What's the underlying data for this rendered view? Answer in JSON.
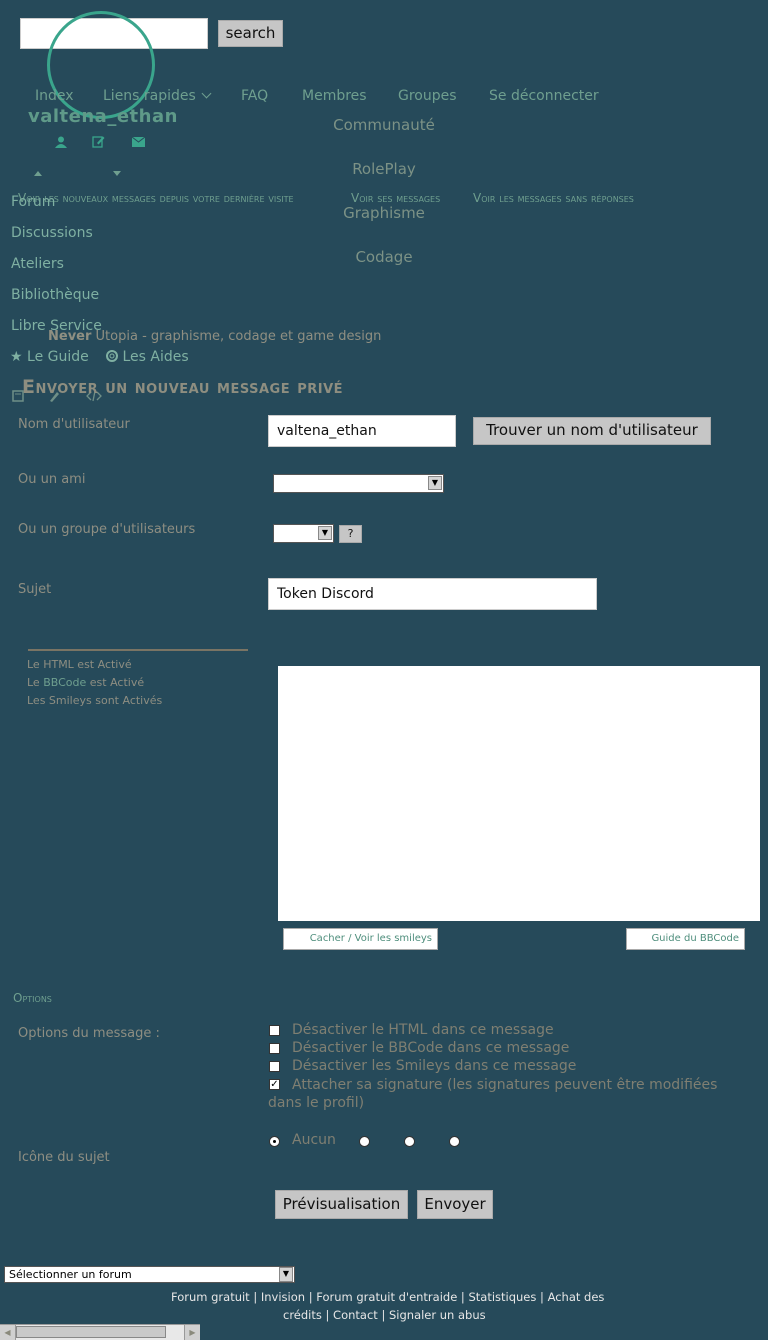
{
  "search": {
    "button_label": "search",
    "value": ""
  },
  "nav": {
    "items": [
      "Index",
      "Liens rapides",
      "FAQ",
      "Membres",
      "Groupes",
      "Se déconnecter"
    ],
    "caret": "⌄"
  },
  "user": {
    "name": "valtena_ethan"
  },
  "categories": [
    "Communauté",
    "RolePlay",
    "Graphisme",
    "Codage"
  ],
  "quick_links": [
    "Voir les nouveaux messages depuis votre dernière visite",
    "Voir ses messages",
    "Voir les messages sans réponses"
  ],
  "sidebar": {
    "items": [
      "Forum",
      "Discussions",
      "Ateliers",
      "Bibliothèque",
      "Libre Service"
    ],
    "guide": "Le Guide",
    "aides": "Les Aides"
  },
  "breadcrumb": {
    "site_strong": "Never",
    "site_rest": "Utopia - graphisme, codage et game design"
  },
  "page_title": "Envoyer un nouveau message privé",
  "form": {
    "username_label": "Nom d'utilisateur",
    "username_value": "valtena_ethan",
    "find_user_button": "Trouver un nom d'utilisateur",
    "friend_label": "Ou un ami",
    "group_label": "Ou un groupe d'utilisateurs",
    "help_button": "?",
    "subject_label": "Sujet",
    "subject_value": "Token Discord",
    "html_status": "Le HTML est Activé",
    "bbcode_prefix": "Le ",
    "bbcode_link": "BBCode",
    "bbcode_suffix": " est Activé",
    "smileys_status": "Les Smileys sont Activés",
    "message_value": "",
    "toggle_smileys": "Cacher / Voir les smileys",
    "bbcode_guide": "Guide du BBCode"
  },
  "options": {
    "heading": "Options",
    "message_options_label": "Options du message :",
    "checkboxes": [
      {
        "label": "Désactiver le HTML dans ce message",
        "checked": false
      },
      {
        "label": "Désactiver le BBCode dans ce message",
        "checked": false
      },
      {
        "label": "Désactiver les Smileys dans ce message",
        "checked": false
      },
      {
        "label": "Attacher sa signature (les signatures peuvent être modifiées dans le profil)",
        "checked": true
      }
    ],
    "topic_icon_label": "Icône du sujet",
    "icon_none": "Aucun"
  },
  "actions": {
    "preview": "Prévisualisation",
    "send": "Envoyer"
  },
  "footer": {
    "forum_select": "Sélectionner un forum",
    "links_line1": "Forum gratuit | Invision | Forum gratuit d'entraide | Statistiques | Achat des",
    "links_line2": "crédits | Contact | Signaler un abus"
  },
  "colors": {
    "background": "#264a5a",
    "accent": "#3aa58c",
    "nav": "#6f9f8f",
    "text_muted": "#8a8a7c"
  }
}
